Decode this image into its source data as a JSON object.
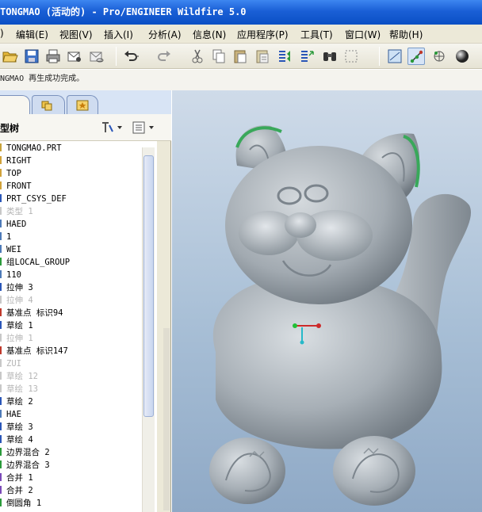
{
  "window": {
    "title": "TONGMAO (活动的) - Pro/ENGINEER Wildfire 5.0"
  },
  "menu": {
    "items": [
      {
        "label": ")"
      },
      {
        "label": "编辑(E)"
      },
      {
        "label": "视图(V)"
      },
      {
        "label": "插入(I)"
      },
      {
        "label": "分析(A)"
      },
      {
        "label": "信息(N)"
      },
      {
        "label": "应用程序(P)"
      },
      {
        "label": "工具(T)"
      },
      {
        "label": "窗口(W)"
      },
      {
        "label": "帮助(H)"
      }
    ]
  },
  "message": {
    "text": "NGMAO 再生成功完成。"
  },
  "navigator": {
    "title": "型树"
  },
  "model_tree": {
    "rows": [
      {
        "label": "TONGMAO.PRT",
        "state": "active",
        "icon": "part-icon"
      },
      {
        "label": "RIGHT",
        "state": "active",
        "icon": "datum-plane-icon"
      },
      {
        "label": "TOP",
        "state": "active",
        "icon": "datum-plane-icon"
      },
      {
        "label": "FRONT",
        "state": "active",
        "icon": "datum-plane-icon"
      },
      {
        "label": "PRT_CSYS_DEF",
        "state": "active",
        "icon": "csys-icon"
      },
      {
        "label": "类型 1",
        "state": "suppressed",
        "icon": "feature-icon"
      },
      {
        "label": "HAED",
        "state": "active",
        "icon": "feature-icon"
      },
      {
        "label": "1",
        "state": "active",
        "icon": "feature-icon"
      },
      {
        "label": "WEI",
        "state": "active",
        "icon": "feature-icon"
      },
      {
        "label": "组LOCAL_GROUP",
        "state": "active",
        "icon": "group-icon"
      },
      {
        "label": "110",
        "state": "active",
        "icon": "feature-icon"
      },
      {
        "label": "拉伸 3",
        "state": "active",
        "icon": "extrude-icon"
      },
      {
        "label": "拉伸 4",
        "state": "suppressed",
        "icon": "extrude-icon"
      },
      {
        "label": "基准点 标识94",
        "state": "active",
        "icon": "datum-point-icon"
      },
      {
        "label": "草绘 1",
        "state": "active",
        "icon": "sketch-icon"
      },
      {
        "label": "拉伸 1",
        "state": "suppressed",
        "icon": "extrude-icon"
      },
      {
        "label": "基准点 标识147",
        "state": "active",
        "icon": "datum-point-icon"
      },
      {
        "label": "ZUI",
        "state": "suppressed",
        "icon": "feature-icon"
      },
      {
        "label": "草绘 12",
        "state": "suppressed",
        "icon": "sketch-icon"
      },
      {
        "label": "草绘 13",
        "state": "suppressed",
        "icon": "sketch-icon"
      },
      {
        "label": "草绘 2",
        "state": "active",
        "icon": "sketch-icon"
      },
      {
        "label": "HAE",
        "state": "active",
        "icon": "feature-icon"
      },
      {
        "label": "草绘 3",
        "state": "active",
        "icon": "sketch-icon"
      },
      {
        "label": "草绘 4",
        "state": "active",
        "icon": "sketch-icon"
      },
      {
        "label": "边界混合 2",
        "state": "active",
        "icon": "boundary-blend-icon"
      },
      {
        "label": "边界混合 3",
        "state": "active",
        "icon": "boundary-blend-icon"
      },
      {
        "label": "合并 1",
        "state": "active",
        "icon": "merge-icon"
      },
      {
        "label": "合并 2",
        "state": "active",
        "icon": "merge-icon"
      },
      {
        "label": "倒圆角 1",
        "state": "active",
        "icon": "round-icon"
      }
    ]
  },
  "toolbar": {
    "buttons": [
      "open-icon",
      "save-icon",
      "print-icon",
      "email-icon",
      "email-link-icon",
      "undo-icon",
      "redo-icon",
      "cut-icon",
      "copy-icon",
      "paste-icon",
      "paste-special-icon",
      "regenerate-icon",
      "regenerate-manager-icon",
      "find-icon",
      "select-box-icon",
      "datum-plane-toggle-icon",
      "datum-axis-toggle-icon",
      "datum-point-toggle-icon",
      "shading-icon"
    ]
  },
  "colors": {
    "titlebar": "#1a5fd6",
    "viewport_top": "#cfdbe9",
    "model": "#a9b0b6",
    "highlight": "#39a85a"
  }
}
